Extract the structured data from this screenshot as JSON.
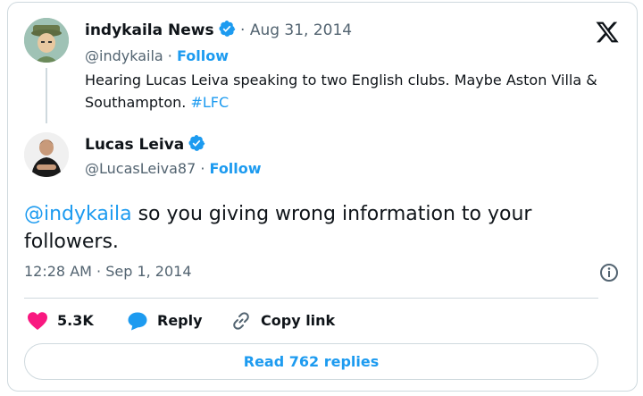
{
  "quoted_tweet": {
    "author_name": "indykaila News",
    "date": "Aug 31, 2014",
    "handle": "@indykaila",
    "follow_label": "Follow",
    "text_main": "Hearing Lucas Leiva speaking to two English clubs. Maybe Aston Villa & Southampton.",
    "hashtag": "#LFC"
  },
  "main_tweet": {
    "author_name": "Lucas Leiva",
    "handle": "@LucasLeiva87",
    "follow_label": "Follow",
    "mention": "@indykaila",
    "text": "so you giving wrong information to your followers.",
    "timestamp": "12:28 AM · Sep 1, 2014"
  },
  "actions": {
    "likes": "5.3K",
    "reply_label": "Reply",
    "copy_label": "Copy link"
  },
  "read_replies_label": "Read 762 replies",
  "icons": {
    "verified": "verified-badge-icon",
    "logo": "x-logo-icon",
    "like": "heart-icon",
    "reply": "speech-bubble-icon",
    "copy": "link-icon",
    "info": "info-icon"
  },
  "colors": {
    "accent": "#1d9bf0",
    "like": "#f91880",
    "muted": "#536471",
    "border": "#cfd9de"
  }
}
